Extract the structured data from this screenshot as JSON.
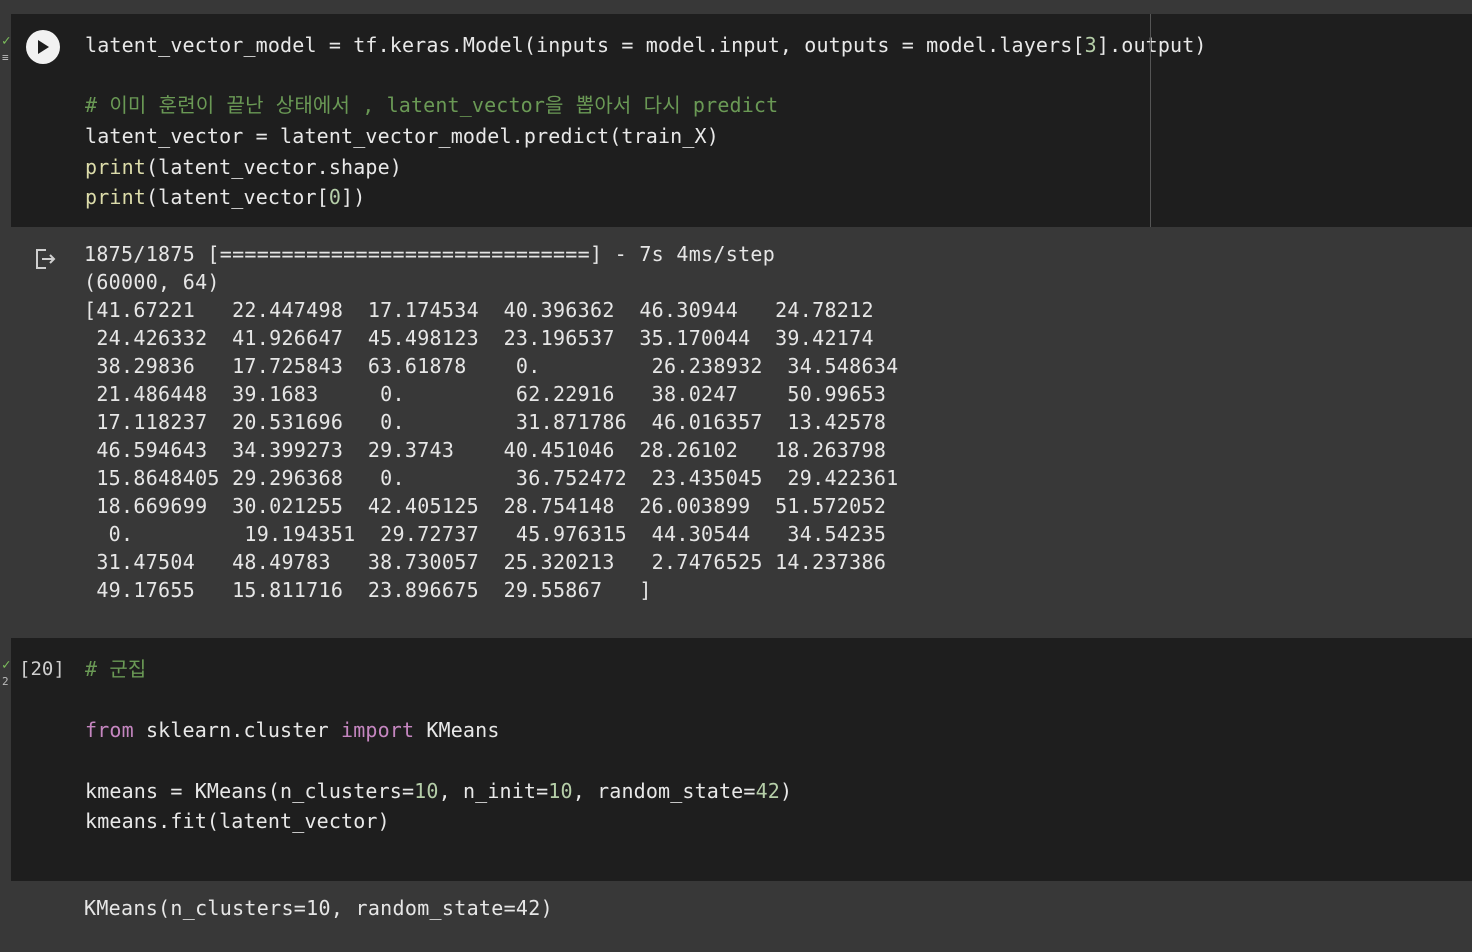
{
  "cell1": {
    "code": {
      "line1": {
        "pre": "latent_vector_model = tf.keras.Model(inputs = model.input, outputs = model.layers[",
        "num": "3",
        "post": "].output)"
      },
      "line2": "# 이미 훈련이 끝난 상태에서 , latent_vector을 뽑아서 다시 predict",
      "line3": "latent_vector = latent_vector_model.predict(train_X)",
      "line4": {
        "fn": "print",
        "rest": "(latent_vector.shape)"
      },
      "line5": {
        "fn": "print",
        "mid": "(latent_vector[",
        "num": "0",
        "post": "])"
      }
    },
    "output": {
      "progress": "1875/1875 [==============================] - 7s 4ms/step",
      "shape": "(60000, 64)",
      "rows": [
        "[41.67221   22.447498  17.174534  40.396362  46.30944   24.78212",
        " 24.426332  41.926647  45.498123  23.196537  35.170044  39.42174",
        " 38.29836   17.725843  63.61878    0.         26.238932  34.548634",
        " 21.486448  39.1683     0.         62.22916   38.0247    50.99653",
        " 17.118237  20.531696   0.         31.871786  46.016357  13.42578",
        " 46.594643  34.399273  29.3743    40.451046  28.26102   18.263798",
        " 15.8648405 29.296368   0.         36.752472  23.435045  29.422361",
        " 18.669699  30.021255  42.405125  28.754148  26.003899  51.572052",
        "  0.         19.194351  29.72737   45.976315  44.30544   34.54235",
        " 31.47504   48.49783   38.730057  25.320213   2.7476525 14.237386",
        " 49.17655   15.811716  23.896675  29.55867   ]"
      ]
    }
  },
  "cell2": {
    "exec_count": "[20]",
    "code": {
      "line1": "# 군집",
      "line2": {
        "kw1": "from",
        "mid": " sklearn.cluster ",
        "kw2": "import",
        "post": " KMeans"
      },
      "line3": {
        "a": "kmeans = KMeans(n_clusters=",
        "n1": "10",
        "b": ", n_init=",
        "n2": "10",
        "c": ", random_state=",
        "n3": "42",
        "d": ")"
      },
      "line4": "kmeans.fit(latent_vector)"
    },
    "output": "KMeans(n_clusters=10, random_state=42)"
  },
  "colors": {
    "code_bg": "#1e1e1e",
    "page_bg": "#383838",
    "keyword": "#c586c0",
    "function": "#dcdcaa",
    "number": "#b5cea8",
    "comment": "#6a9955"
  },
  "icons": {
    "run": "play-icon",
    "output": "output-redirect-icon",
    "status": "check-icon"
  }
}
